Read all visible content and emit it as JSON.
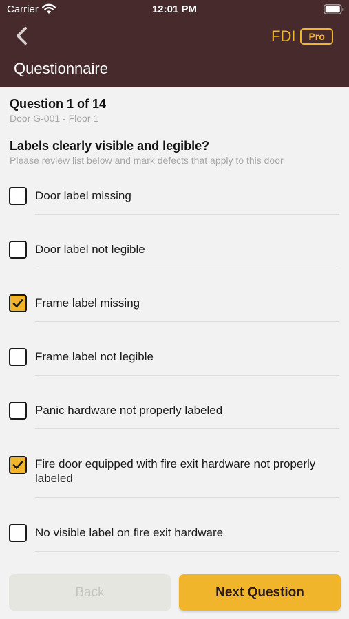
{
  "status_bar": {
    "carrier": "Carrier",
    "time": "12:01 PM"
  },
  "nav": {
    "back_icon": "chevron-left-icon",
    "brand": "FDI",
    "badge": "Pro",
    "title": "Questionnaire"
  },
  "question": {
    "count": "Question 1 of 14",
    "door": "Door G-001 - Floor 1",
    "text": "Labels clearly visible and legible?",
    "instructions": "Please review list below and mark defects that apply to this door"
  },
  "items": [
    {
      "label": "Door label missing",
      "checked": false
    },
    {
      "label": "Door label not legible",
      "checked": false
    },
    {
      "label": "Frame label missing",
      "checked": true
    },
    {
      "label": "Frame label not legible",
      "checked": false
    },
    {
      "label": "Panic hardware not properly labeled",
      "checked": false
    },
    {
      "label": "Fire door equipped with fire exit hardware not properly labeled",
      "checked": true
    },
    {
      "label": "No visible label on fire exit hardware",
      "checked": false
    }
  ],
  "buttons": {
    "back": "Back",
    "next": "Next Question"
  },
  "colors": {
    "header": "#472a2c",
    "accent": "#f1b52b",
    "background": "#f2f2f2"
  }
}
